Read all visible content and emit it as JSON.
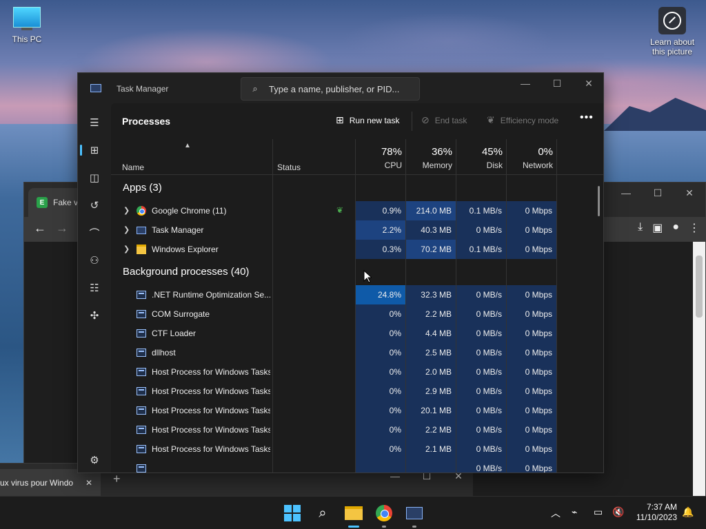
{
  "desktop": {
    "this_pc_label": "This PC",
    "learn_label": "Learn about this picture"
  },
  "browser": {
    "tab_label": "Fake vi",
    "favicon_letter": "E",
    "bottom_tab_label": "ux virus pour Windo"
  },
  "task_manager": {
    "title": "Task Manager",
    "search_placeholder": "Type a name, publisher, or PID...",
    "page_title": "Processes",
    "commands": {
      "run_new_task": "Run new task",
      "end_task": "End task",
      "efficiency_mode": "Efficiency mode"
    },
    "columns": {
      "name": "Name",
      "status": "Status",
      "cpu": {
        "pct": "78%",
        "label": "CPU"
      },
      "memory": {
        "pct": "36%",
        "label": "Memory"
      },
      "disk": {
        "pct": "45%",
        "label": "Disk"
      },
      "network": {
        "pct": "0%",
        "label": "Network"
      }
    },
    "groups": {
      "apps": "Apps (3)",
      "background": "Background processes (40)"
    },
    "apps": [
      {
        "name": "Google Chrome (11)",
        "cpu": "0.9%",
        "memory": "214.0 MB",
        "disk": "0.1 MB/s",
        "network": "0 Mbps"
      },
      {
        "name": "Task Manager",
        "cpu": "2.2%",
        "memory": "40.3 MB",
        "disk": "0 MB/s",
        "network": "0 Mbps"
      },
      {
        "name": "Windows Explorer",
        "cpu": "0.3%",
        "memory": "70.2 MB",
        "disk": "0.1 MB/s",
        "network": "0 Mbps"
      }
    ],
    "background": [
      {
        "name": ".NET Runtime Optimization Se...",
        "cpu": "24.8%",
        "memory": "32.3 MB",
        "disk": "0 MB/s",
        "network": "0 Mbps"
      },
      {
        "name": "COM Surrogate",
        "cpu": "0%",
        "memory": "2.2 MB",
        "disk": "0 MB/s",
        "network": "0 Mbps"
      },
      {
        "name": "CTF Loader",
        "cpu": "0%",
        "memory": "4.4 MB",
        "disk": "0 MB/s",
        "network": "0 Mbps"
      },
      {
        "name": "dllhost",
        "cpu": "0%",
        "memory": "2.5 MB",
        "disk": "0 MB/s",
        "network": "0 Mbps"
      },
      {
        "name": "Host Process for Windows Tasks",
        "cpu": "0%",
        "memory": "2.0 MB",
        "disk": "0 MB/s",
        "network": "0 Mbps"
      },
      {
        "name": "Host Process for Windows Tasks",
        "cpu": "0%",
        "memory": "2.9 MB",
        "disk": "0 MB/s",
        "network": "0 Mbps"
      },
      {
        "name": "Host Process for Windows Tasks",
        "cpu": "0%",
        "memory": "20.1 MB",
        "disk": "0 MB/s",
        "network": "0 Mbps"
      },
      {
        "name": "Host Process for Windows Tasks",
        "cpu": "0%",
        "memory": "2.2 MB",
        "disk": "0 MB/s",
        "network": "0 Mbps"
      },
      {
        "name": "Host Process for Windows Tasks",
        "cpu": "0%",
        "memory": "2.1 MB",
        "disk": "0 MB/s",
        "network": "0 Mbps"
      },
      {
        "name": "",
        "cpu": "",
        "memory": "",
        "disk": "0 MB/s",
        "network": "0 Mbps"
      }
    ],
    "heat_colors": {
      "low": "#19315a",
      "mid": "#1d4380",
      "high": "#0f5aa8"
    }
  },
  "taskbar": {
    "time": "7:37 AM",
    "date": "11/10/2023"
  }
}
